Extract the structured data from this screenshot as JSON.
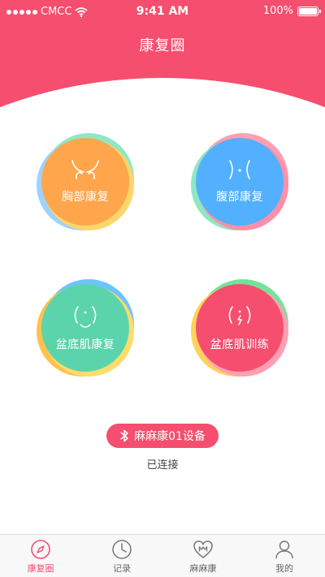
{
  "status_bar": {
    "carrier": "CMCC",
    "time": "9:41 AM",
    "battery": "100%"
  },
  "nav": {
    "title": "康复圈"
  },
  "cards": [
    {
      "label": "胸部康复",
      "icon": "chest-icon",
      "core_color": "#ffa64d"
    },
    {
      "label": "腹部康复",
      "icon": "abdomen-icon",
      "core_color": "#52b0ff"
    },
    {
      "label": "盆底肌康复",
      "icon": "pelvic-icon",
      "core_color": "#5cd4ab"
    },
    {
      "label": "盆底肌训练",
      "icon": "training-icon",
      "core_color": "#f54e6e"
    }
  ],
  "device": {
    "name": "麻麻康01设备",
    "status": "已连接",
    "icon": "bluetooth-icon"
  },
  "tabbar": {
    "items": [
      {
        "label": "康复圈",
        "icon": "compass-icon",
        "active": true
      },
      {
        "label": "记录",
        "icon": "clock-icon",
        "active": false
      },
      {
        "label": "麻麻康",
        "icon": "heart-m-icon",
        "active": false
      },
      {
        "label": "我的",
        "icon": "user-icon",
        "active": false
      }
    ]
  },
  "colors": {
    "accent": "#f54e6e",
    "orange": "#ffa64d",
    "blue": "#52b0ff",
    "green": "#5cd4ab",
    "tab_inactive": "#666666"
  }
}
